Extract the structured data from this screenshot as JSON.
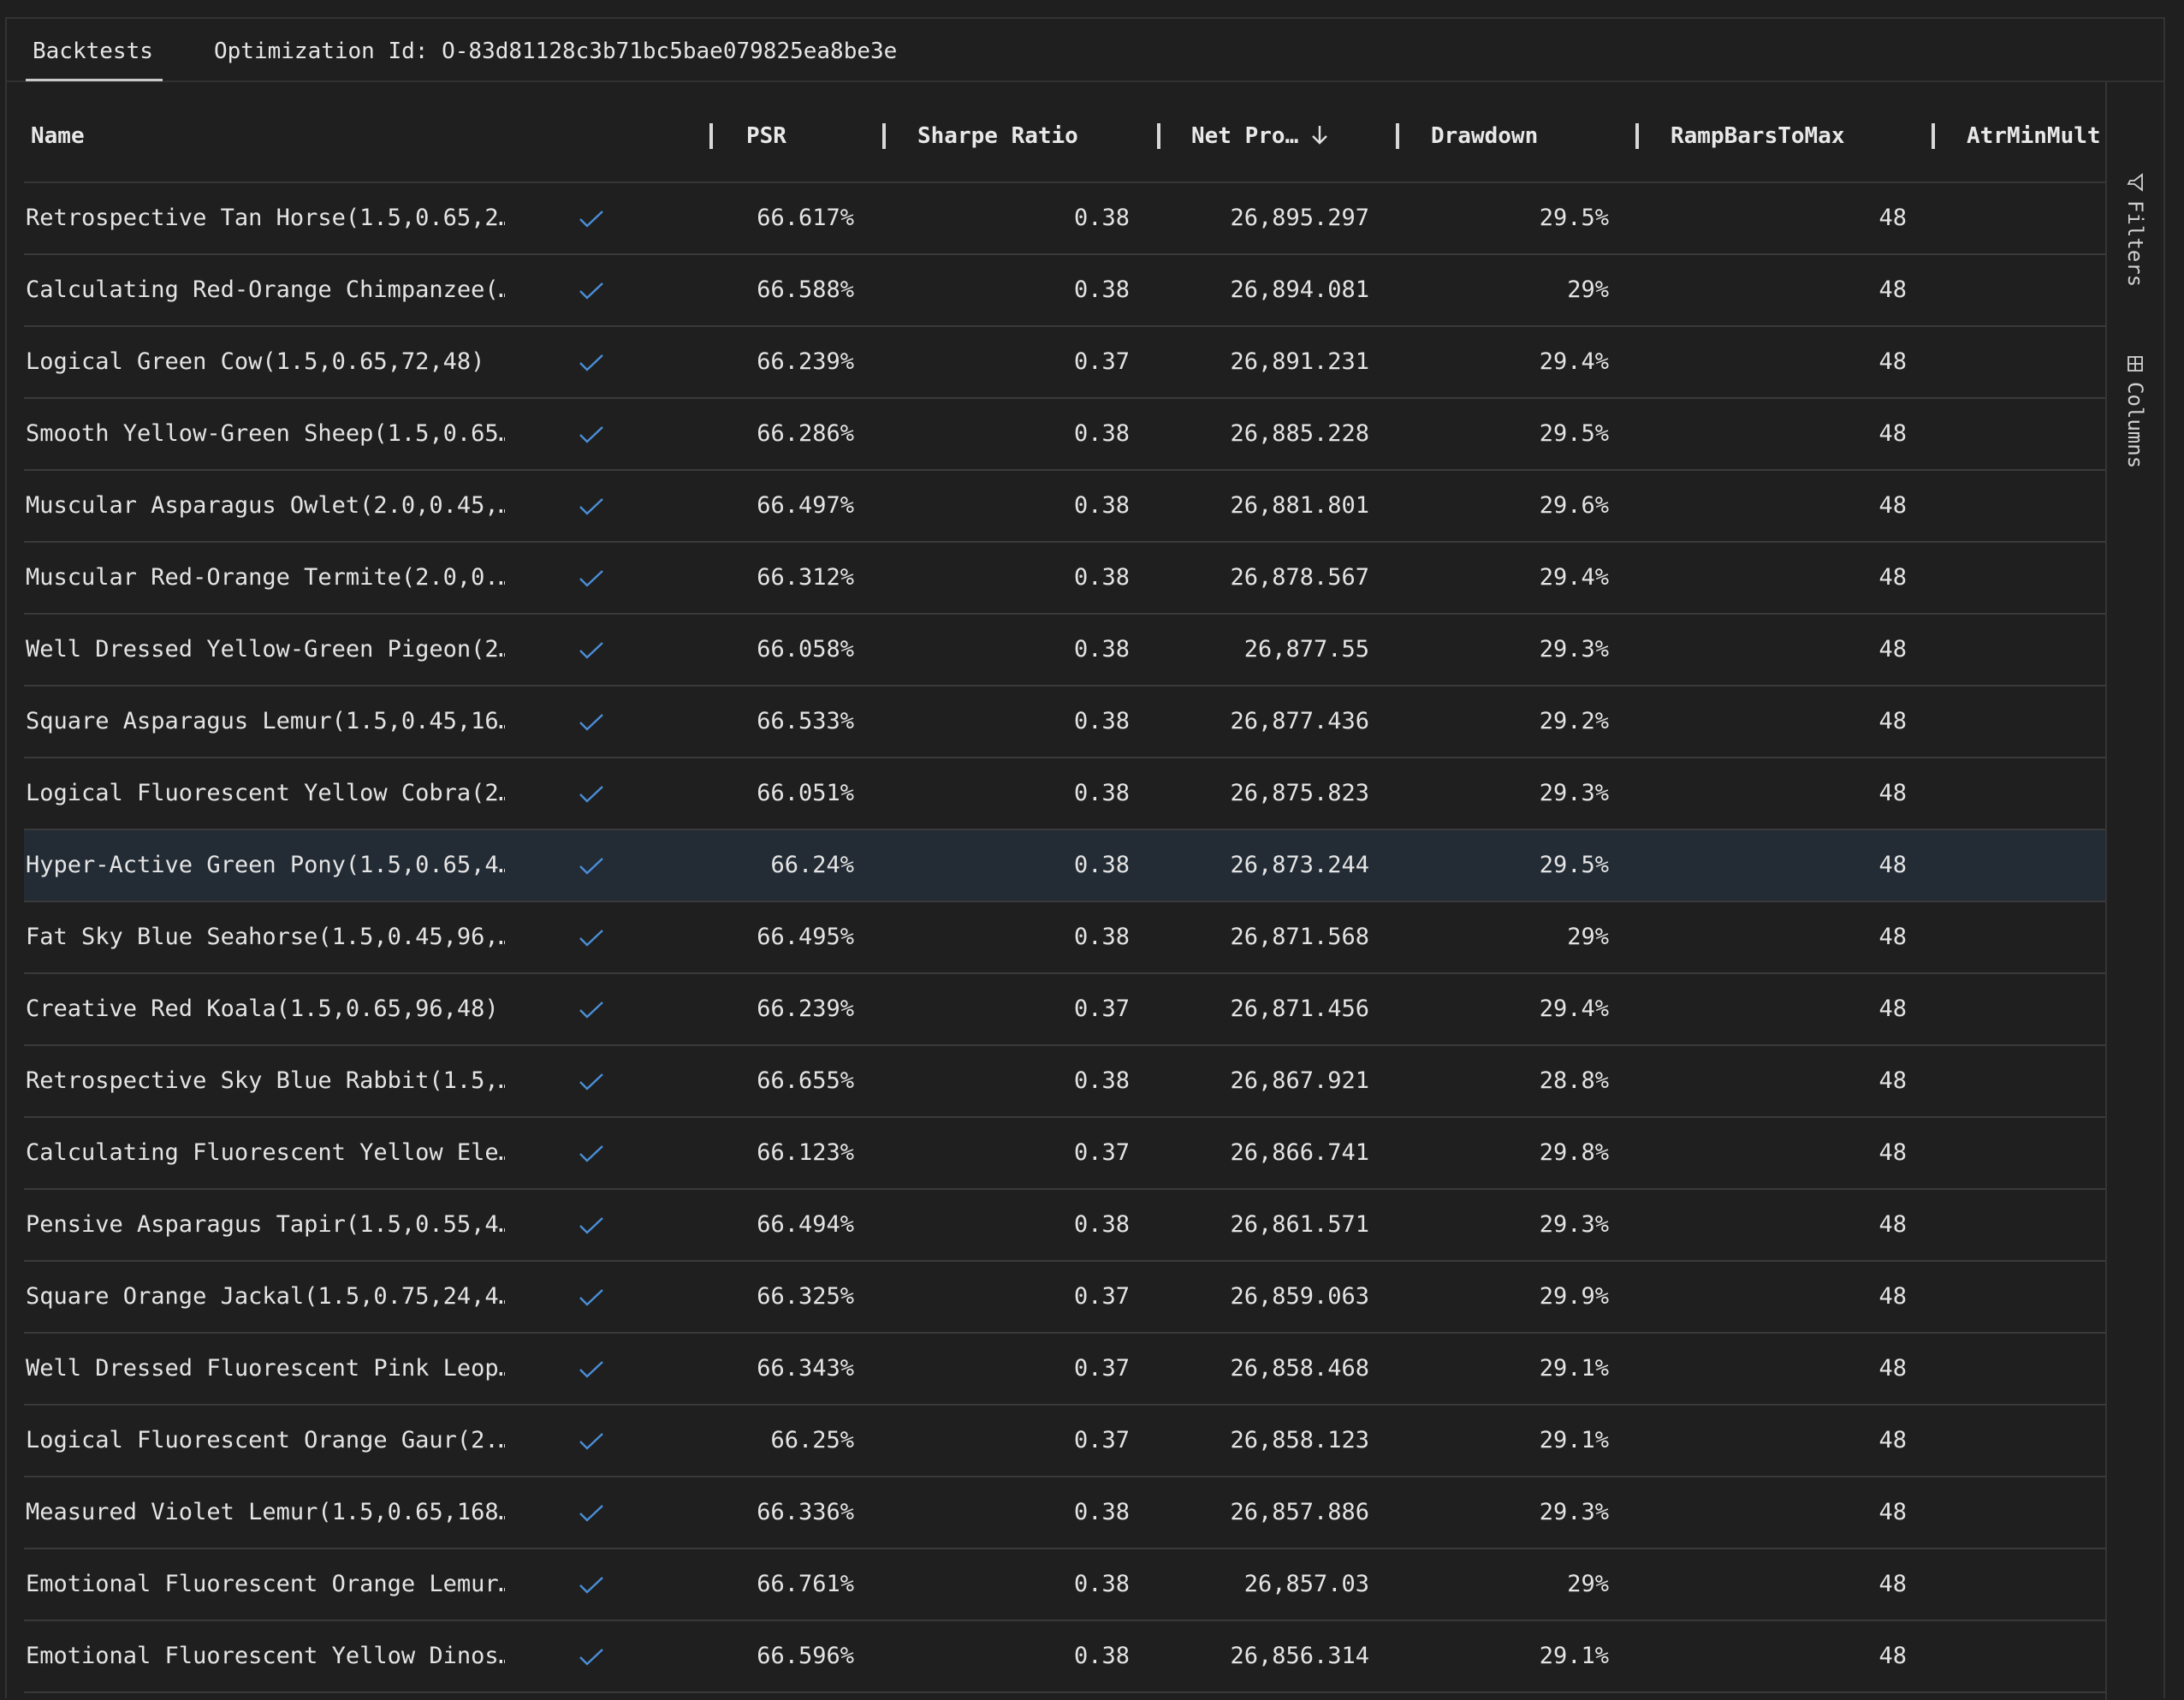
{
  "tabs": {
    "backtests": "Backtests",
    "optimization": "Optimization Id: O-83d81128c3b71bc5bae079825ea8be3e"
  },
  "columns": {
    "name": "Name",
    "psr": "PSR",
    "sharpe": "Sharpe Ratio",
    "netpro": "Net Pro…",
    "drawdown": "Drawdown",
    "ramp": "RampBarsToMax",
    "atr": "AtrMinMult"
  },
  "icons": {
    "check": "check-icon",
    "sort": "arrow-down-icon",
    "filter": "filter-icon",
    "columns": "columns-icon"
  },
  "sidebar": {
    "filters": "Filters",
    "columns": "Columns"
  },
  "selected_row_index": 9,
  "rows": [
    {
      "name": "Retrospective Tan Horse(1.5,0.65,2…",
      "psr": "66.617%",
      "sharpe": "0.38",
      "netpro": "26,895.297",
      "drawdown": "29.5%",
      "ramp": "48"
    },
    {
      "name": "Calculating Red-Orange Chimpanzee(…",
      "psr": "66.588%",
      "sharpe": "0.38",
      "netpro": "26,894.081",
      "drawdown": "29%",
      "ramp": "48"
    },
    {
      "name": "Logical Green Cow(1.5,0.65,72,48)",
      "psr": "66.239%",
      "sharpe": "0.37",
      "netpro": "26,891.231",
      "drawdown": "29.4%",
      "ramp": "48"
    },
    {
      "name": "Smooth Yellow-Green Sheep(1.5,0.65…",
      "psr": "66.286%",
      "sharpe": "0.38",
      "netpro": "26,885.228",
      "drawdown": "29.5%",
      "ramp": "48"
    },
    {
      "name": "Muscular Asparagus Owlet(2.0,0.45,…",
      "psr": "66.497%",
      "sharpe": "0.38",
      "netpro": "26,881.801",
      "drawdown": "29.6%",
      "ramp": "48"
    },
    {
      "name": "Muscular Red-Orange Termite(2.0,0.…",
      "psr": "66.312%",
      "sharpe": "0.38",
      "netpro": "26,878.567",
      "drawdown": "29.4%",
      "ramp": "48"
    },
    {
      "name": "Well Dressed Yellow-Green Pigeon(2…",
      "psr": "66.058%",
      "sharpe": "0.38",
      "netpro": "26,877.55",
      "drawdown": "29.3%",
      "ramp": "48"
    },
    {
      "name": "Square Asparagus Lemur(1.5,0.45,16…",
      "psr": "66.533%",
      "sharpe": "0.38",
      "netpro": "26,877.436",
      "drawdown": "29.2%",
      "ramp": "48"
    },
    {
      "name": "Logical Fluorescent Yellow Cobra(2…",
      "psr": "66.051%",
      "sharpe": "0.38",
      "netpro": "26,875.823",
      "drawdown": "29.3%",
      "ramp": "48"
    },
    {
      "name": "Hyper-Active Green Pony(1.5,0.65,4…",
      "psr": "66.24%",
      "sharpe": "0.38",
      "netpro": "26,873.244",
      "drawdown": "29.5%",
      "ramp": "48"
    },
    {
      "name": "Fat Sky Blue Seahorse(1.5,0.45,96,…",
      "psr": "66.495%",
      "sharpe": "0.38",
      "netpro": "26,871.568",
      "drawdown": "29%",
      "ramp": "48"
    },
    {
      "name": "Creative Red Koala(1.5,0.65,96,48)",
      "psr": "66.239%",
      "sharpe": "0.37",
      "netpro": "26,871.456",
      "drawdown": "29.4%",
      "ramp": "48"
    },
    {
      "name": "Retrospective Sky Blue Rabbit(1.5,…",
      "psr": "66.655%",
      "sharpe": "0.38",
      "netpro": "26,867.921",
      "drawdown": "28.8%",
      "ramp": "48"
    },
    {
      "name": "Calculating Fluorescent Yellow Ele…",
      "psr": "66.123%",
      "sharpe": "0.37",
      "netpro": "26,866.741",
      "drawdown": "29.8%",
      "ramp": "48"
    },
    {
      "name": "Pensive Asparagus Tapir(1.5,0.55,4…",
      "psr": "66.494%",
      "sharpe": "0.38",
      "netpro": "26,861.571",
      "drawdown": "29.3%",
      "ramp": "48"
    },
    {
      "name": "Square Orange Jackal(1.5,0.75,24,4…",
      "psr": "66.325%",
      "sharpe": "0.37",
      "netpro": "26,859.063",
      "drawdown": "29.9%",
      "ramp": "48"
    },
    {
      "name": "Well Dressed Fluorescent Pink Leop…",
      "psr": "66.343%",
      "sharpe": "0.37",
      "netpro": "26,858.468",
      "drawdown": "29.1%",
      "ramp": "48"
    },
    {
      "name": "Logical Fluorescent Orange Gaur(2.…",
      "psr": "66.25%",
      "sharpe": "0.37",
      "netpro": "26,858.123",
      "drawdown": "29.1%",
      "ramp": "48"
    },
    {
      "name": "Measured Violet Lemur(1.5,0.65,168…",
      "psr": "66.336%",
      "sharpe": "0.38",
      "netpro": "26,857.886",
      "drawdown": "29.3%",
      "ramp": "48"
    },
    {
      "name": "Emotional Fluorescent Orange Lemur…",
      "psr": "66.761%",
      "sharpe": "0.38",
      "netpro": "26,857.03",
      "drawdown": "29%",
      "ramp": "48"
    },
    {
      "name": "Emotional Fluorescent Yellow Dinos…",
      "psr": "66.596%",
      "sharpe": "0.38",
      "netpro": "26,856.314",
      "drawdown": "29.1%",
      "ramp": "48"
    }
  ]
}
